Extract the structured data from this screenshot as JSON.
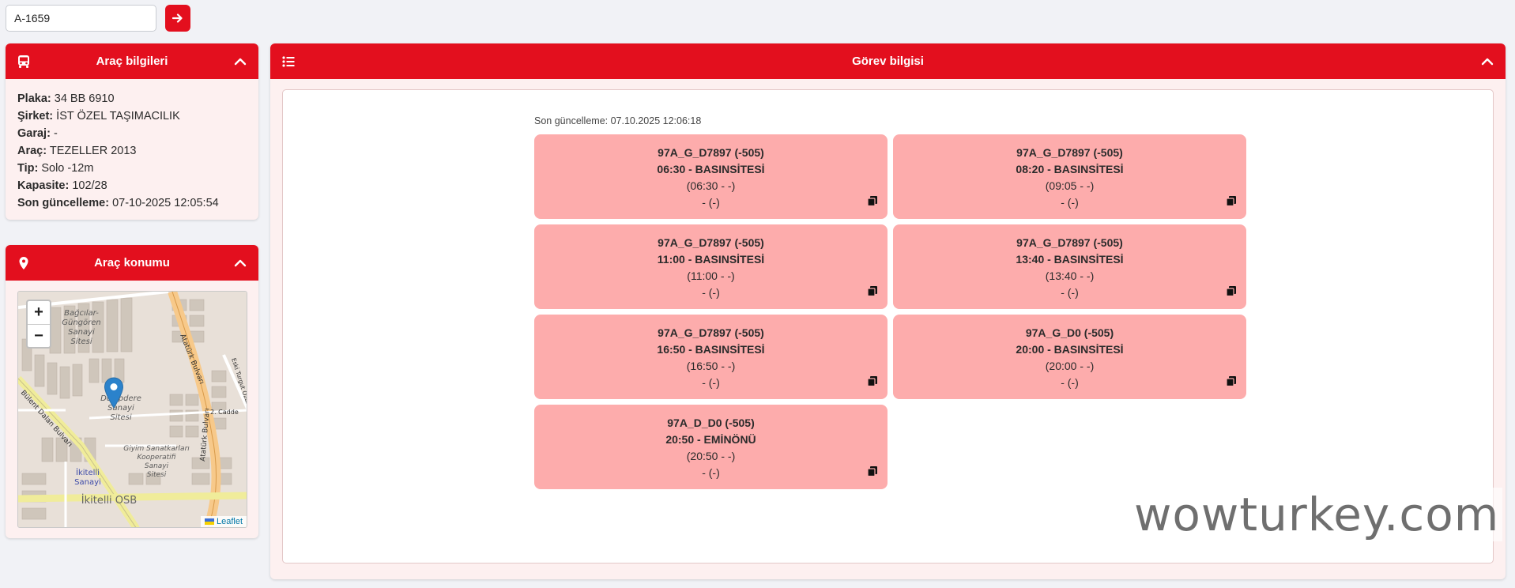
{
  "search": {
    "value": "A-1659"
  },
  "vehicle": {
    "title": "Araç bilgileri",
    "rows": [
      {
        "label": "Plaka:",
        "value": "34 BB 6910"
      },
      {
        "label": "Şirket:",
        "value": "İST ÖZEL TAŞIMACILIK"
      },
      {
        "label": "Garaj:",
        "value": "-"
      },
      {
        "label": "Araç:",
        "value": "TEZELLER 2013"
      },
      {
        "label": "Tip:",
        "value": "Solo -12m"
      },
      {
        "label": "Kapasite:",
        "value": "102/28"
      },
      {
        "label": "Son güncelleme:",
        "value": "07-10-2025 12:05:54"
      }
    ]
  },
  "location": {
    "title": "Araç konumu",
    "zoom_in": "+",
    "zoom_out": "−",
    "attribution": "Leaflet",
    "map_labels": {
      "bagcilar": "Bağcılar-",
      "gungoren": "Güngören",
      "sanayi1": "Sanayi",
      "sitesi1": "Sitesi",
      "ataturk1": "Atatürk Bulvarı",
      "ataturk2": "Atatürk Bulvarı",
      "turgut": "Eski Turgut Özal Caddesi",
      "cadde2": "2. Cadde",
      "dolap": "Dolapdere",
      "sanayi2": "Sanayi",
      "sitesi2": "Sitesi",
      "dalan": "Bülent Dalan Bulvarı",
      "giyim1": "Giyim Sanatkarları",
      "giyim2": "Kooperatifi",
      "giyim3": "Sanayi",
      "giyim4": "Sitesi",
      "ikitelli1": "İkitelli",
      "ikitelli2": "Sanayi",
      "ikitelliosb": "İkitelli OSB"
    }
  },
  "tasks": {
    "title": "Görev bilgisi",
    "updated": "Son güncelleme: 07.10.2025 12:06:18",
    "cards": [
      {
        "route": "97A_G_D7897 (-505)",
        "time": "06:30 - BASINSİTESİ",
        "actual": "(06:30 - -)",
        "status": "- (-)"
      },
      {
        "route": "97A_G_D7897 (-505)",
        "time": "08:20 - BASINSİTESİ",
        "actual": "(09:05 - -)",
        "status": "- (-)"
      },
      {
        "route": "97A_G_D7897 (-505)",
        "time": "11:00 - BASINSİTESİ",
        "actual": "(11:00 - -)",
        "status": "- (-)"
      },
      {
        "route": "97A_G_D7897 (-505)",
        "time": "13:40 - BASINSİTESİ",
        "actual": "(13:40 - -)",
        "status": "- (-)"
      },
      {
        "route": "97A_G_D7897 (-505)",
        "time": "16:50 - BASINSİTESİ",
        "actual": "(16:50 - -)",
        "status": "- (-)"
      },
      {
        "route": "97A_G_D0 (-505)",
        "time": "20:00 - BASINSİTESİ",
        "actual": "(20:00 - -)",
        "status": "- (-)"
      },
      {
        "route": "97A_D_D0 (-505)",
        "time": "20:50 - EMİNÖNÜ",
        "actual": "(20:50 - -)",
        "status": "- (-)"
      }
    ]
  },
  "watermark": "wowturkey.com",
  "colors": {
    "accent": "#e30f1e",
    "card_bg": "#fdacac",
    "panel_bg": "#fdf0f0"
  }
}
